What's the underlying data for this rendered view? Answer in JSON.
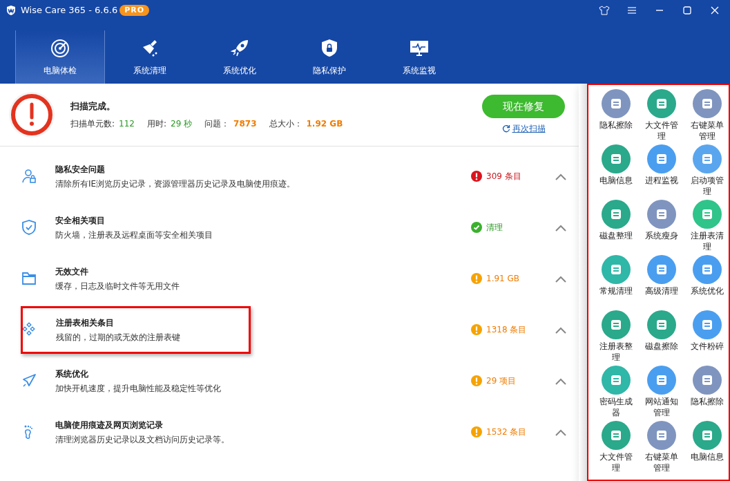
{
  "window": {
    "title": "Wise Care 365 - 6.6.6",
    "badge": "PRO"
  },
  "tabs": [
    {
      "label": "电脑体检",
      "selected": true
    },
    {
      "label": "系统清理",
      "selected": false
    },
    {
      "label": "系统优化",
      "selected": false
    },
    {
      "label": "隐私保护",
      "selected": false
    },
    {
      "label": "系统监视",
      "selected": false
    }
  ],
  "scan": {
    "title": "扫描完成。",
    "stats": [
      {
        "label": "扫描单元数:",
        "value": "112",
        "kind": "good"
      },
      {
        "label": "用时:",
        "value": "29 秒",
        "kind": "good"
      },
      {
        "label": "问题：",
        "value": "7873",
        "kind": "bad"
      },
      {
        "label": "总大小：",
        "value": "1.92 GB",
        "kind": "bad"
      }
    ],
    "fix_button": "现在修复",
    "rescan_link": "再次扫描"
  },
  "items": [
    {
      "title": "隐私安全问题",
      "description": "清除所有IE浏览历史记录，资源管理器历史记录及电脑使用痕迹。",
      "status": "309 条目",
      "kind": "error",
      "highlighted": false
    },
    {
      "title": "安全相关项目",
      "description": "防火墙，注册表及远程桌面等安全相关项目",
      "status": "清理",
      "kind": "ok",
      "highlighted": false
    },
    {
      "title": "无效文件",
      "description": "缓存，日志及临时文件等无用文件",
      "status": "1.91 GB",
      "kind": "warning",
      "highlighted": false
    },
    {
      "title": "注册表相关条目",
      "description": "残留的，过期的或无效的注册表键",
      "status": "1318 条目",
      "kind": "warning",
      "highlighted": true
    },
    {
      "title": "系统优化",
      "description": "加快开机速度，提升电脑性能及稳定性等优化",
      "status": "29 项目",
      "kind": "warning",
      "highlighted": false
    },
    {
      "title": "电脑使用痕迹及网页浏览记录",
      "description": "清理浏览器历史记录以及文档访问历史记录等。",
      "status": "1532 条目",
      "kind": "warning",
      "highlighted": false
    }
  ],
  "tools": {
    "highlighted": true,
    "items": [
      {
        "label": "隐私擦除",
        "color": "#7f95bf"
      },
      {
        "label": "大文件管理",
        "color": "#2aa98b"
      },
      {
        "label": "右键菜单管理",
        "color": "#7f95bf"
      },
      {
        "label": "电脑信息",
        "color": "#2aa98b"
      },
      {
        "label": "进程监视",
        "color": "#4a9ef0"
      },
      {
        "label": "启动项管理",
        "color": "#5aa6ee"
      },
      {
        "label": "磁盘整理",
        "color": "#2aa98b"
      },
      {
        "label": "系统瘦身",
        "color": "#7f95bf"
      },
      {
        "label": "注册表清理",
        "color": "#2fc48a"
      },
      {
        "label": "常规清理",
        "color": "#2fb7a8"
      },
      {
        "label": "高级清理",
        "color": "#4a9ef0"
      },
      {
        "label": "系统优化",
        "color": "#4a9ef0"
      },
      {
        "label": "注册表整理",
        "color": "#2aa98b"
      },
      {
        "label": "磁盘擦除",
        "color": "#2aa98b"
      },
      {
        "label": "文件粉碎",
        "color": "#4a9ef0"
      },
      {
        "label": "密码生成器",
        "color": "#2fb7a8"
      },
      {
        "label": "网站通知管理",
        "color": "#4a9ef0"
      },
      {
        "label": "隐私擦除",
        "color": "#7f95bf"
      },
      {
        "label": "大文件管理",
        "color": "#2aa98b"
      },
      {
        "label": "右键菜单管理",
        "color": "#7f95bf"
      },
      {
        "label": "电脑信息",
        "color": "#2aa98b"
      }
    ]
  }
}
